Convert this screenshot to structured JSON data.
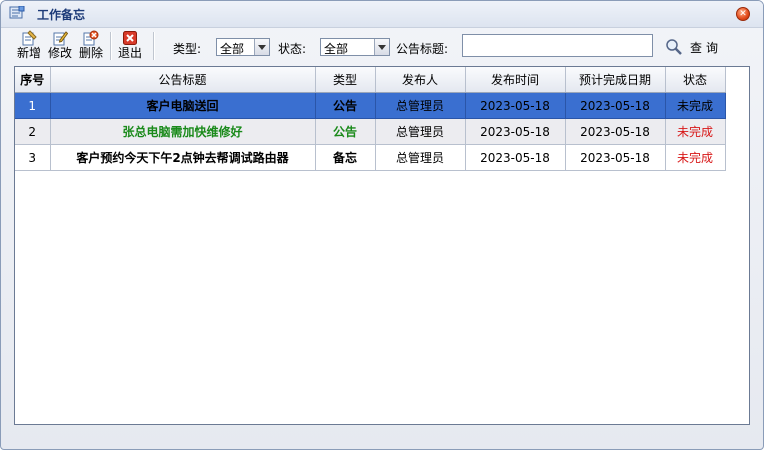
{
  "window": {
    "title": "工作备忘"
  },
  "toolbar": {
    "new_label": "新增",
    "edit_label": "修改",
    "delete_label": "删除",
    "exit_label": "退出",
    "type_label": "类型:",
    "type_value": "全部",
    "status_label": "状态:",
    "status_value": "全部",
    "title_label": "公告标题:",
    "title_value": "",
    "search_label": "查询"
  },
  "table": {
    "columns": [
      "序号",
      "公告标题",
      "类型",
      "发布人",
      "发布时间",
      "预计完成日期",
      "状态"
    ],
    "rows": [
      {
        "seq": "1",
        "title": "客户电脑送回",
        "type": "公告",
        "publisher": "总管理员",
        "published": "2023-05-18",
        "due": "2023-05-18",
        "status": "未完成"
      },
      {
        "seq": "2",
        "title": "张总电脑需加快维修好",
        "type": "公告",
        "publisher": "总管理员",
        "published": "2023-05-18",
        "due": "2023-05-18",
        "status": "未完成"
      },
      {
        "seq": "3",
        "title": "客户预约今天下午2点钟去帮调试路由器",
        "type": "备忘",
        "publisher": "总管理员",
        "published": "2023-05-18",
        "due": "2023-05-18",
        "status": "未完成"
      }
    ]
  },
  "colors": {
    "selected_row": "#3a6fd0",
    "green_text": "#1a8a1a",
    "red_text": "#d81818",
    "title_text": "#1c3a78"
  },
  "icons": [
    "memo-icon",
    "close-icon",
    "new-icon",
    "edit-icon",
    "delete-icon",
    "exit-icon",
    "search-icon"
  ]
}
